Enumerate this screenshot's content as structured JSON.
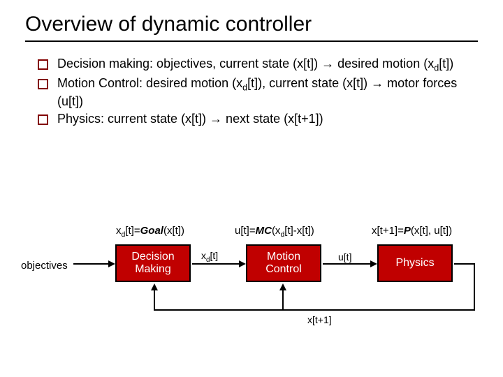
{
  "title": "Overview of dynamic controller",
  "bullets": {
    "b1_pre": "Decision making: objectives, current state (x[t]) → desired motion (x",
    "b1_sub": "d",
    "b1_post": "[t])",
    "b2_pre": "Motion Control: desired motion (x",
    "b2_sub": "d",
    "b2_post": "[t]), current state (x[t]) → motor forces (u[t])",
    "b3": "Physics: current state (x[t]) → next state (x[t+1])"
  },
  "eq": {
    "e1_sub": "d",
    "e1_after": "[t]=",
    "e1_func": "Goal",
    "e1_args": "(x[t])",
    "e2_pre": "u[t]=",
    "e2_func": "MC",
    "e2_mid": "(x",
    "e2_sub": "d",
    "e2_post": "[t]-x[t])",
    "e3_pre": "x[t+1]=",
    "e3_func": "P",
    "e3_args": "(x[t], u[t])"
  },
  "labels": {
    "objectives": "objectives",
    "xd_pre": "x",
    "xd_sub": "d",
    "xd_post": "[t]",
    "ut": "u[t]",
    "xtp1": "x[t+1]"
  },
  "boxes": {
    "decision": "Decision\nMaking",
    "motion": "Motion\nControl",
    "physics": "Physics"
  }
}
